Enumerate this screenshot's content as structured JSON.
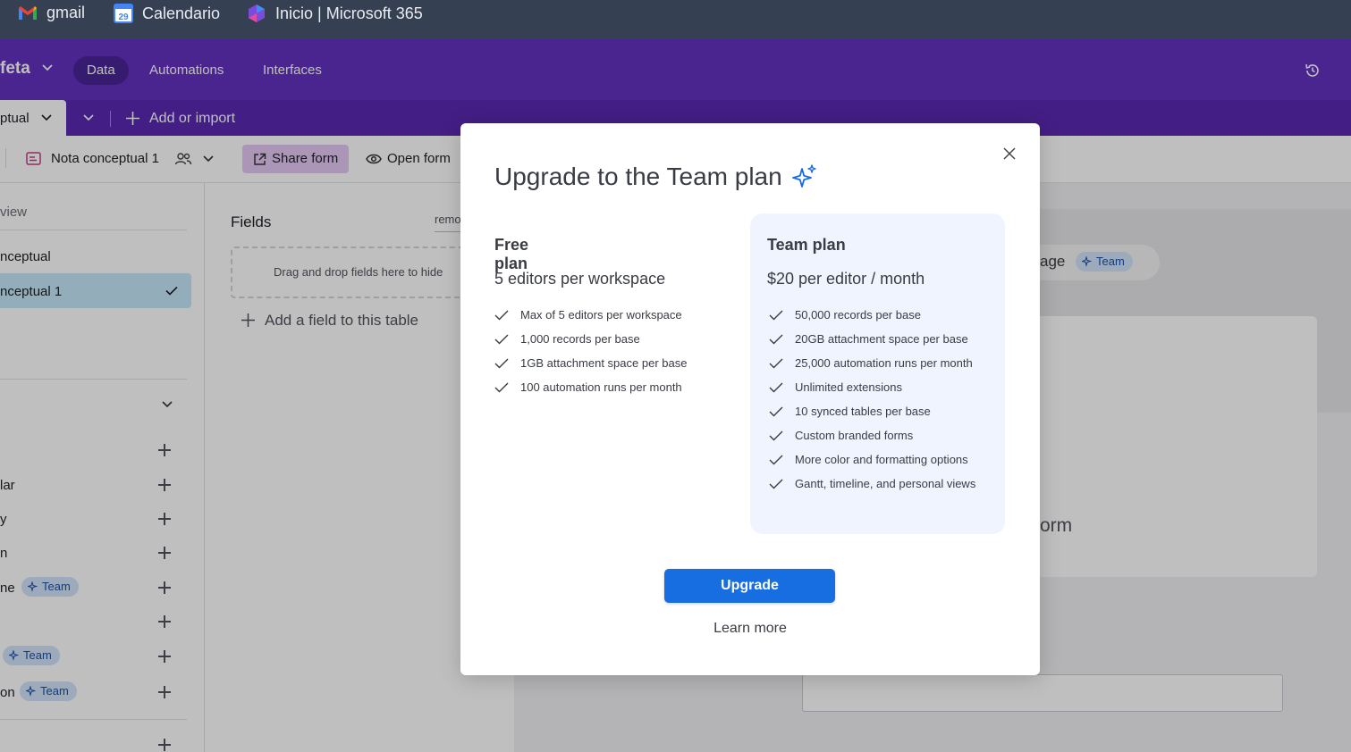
{
  "browser": {
    "bookmarks": [
      {
        "label": "gmail",
        "icon": "gmail-icon"
      },
      {
        "label": "Calendario",
        "icon": "calendar-icon",
        "badge": "29"
      },
      {
        "label": "Inicio | Microsoft 365",
        "icon": "microsoft365-icon"
      }
    ]
  },
  "app": {
    "base_name": "feta",
    "nav": [
      "Data",
      "Automations",
      "Interfaces"
    ],
    "active_nav": "Data"
  },
  "tabs": {
    "active_table": "ptual",
    "add_label": "Add or import"
  },
  "toolbar": {
    "view_name": "Nota conceptual 1",
    "share_label": "Share form",
    "open_label": "Open form"
  },
  "sidebar": {
    "search_placeholder": "view",
    "views": [
      "nceptual",
      "nceptual 1"
    ],
    "create_items": [
      {
        "label": ""
      },
      {
        "label": "lar"
      },
      {
        "label": "y"
      },
      {
        "label": "n"
      },
      {
        "label": "ne",
        "badge": "Team"
      },
      {
        "label": ""
      },
      {
        "label": "",
        "badge": "Team"
      },
      {
        "label": "on",
        "badge": "Team"
      },
      {
        "label": ""
      }
    ]
  },
  "fields_panel": {
    "title": "Fields",
    "remove_link": "remo",
    "dropzone_text": "Drag and drop fields here to hide",
    "add_field": "Add a field to this table"
  },
  "canvas": {
    "manage_partial": "age",
    "team_badge": "Team",
    "form_partial": "orm"
  },
  "modal": {
    "title": "Upgrade to the Team plan",
    "free": {
      "name": "Free plan",
      "price": "5 editors per workspace",
      "features": [
        "Max of 5 editors per workspace",
        "1,000 records per base",
        "1GB attachment space per base",
        "100 automation runs per month"
      ]
    },
    "team": {
      "name": "Team plan",
      "price": "$20 per editor / month",
      "features": [
        "50,000 records per base",
        "20GB attachment space per base",
        "25,000 automation runs per month",
        "Unlimited extensions",
        "10 synced tables per base",
        "Custom branded forms",
        "More color and formatting options",
        "Gantt, timeline, and personal views"
      ]
    },
    "upgrade_label": "Upgrade",
    "learn_more": "Learn more"
  },
  "colors": {
    "accent": "#166ee1",
    "header_purple": "#6330bf",
    "team_badge_bg": "#d0e3fb"
  }
}
